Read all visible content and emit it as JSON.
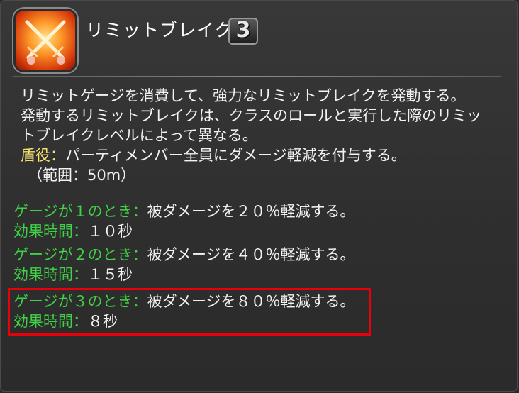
{
  "action": {
    "name": "リミットブレイク",
    "level": "3"
  },
  "description": {
    "line1": "リミットゲージを消費して、強力なリミットブレイクを発動する。",
    "line2": "発動するリミットブレイクは、クラスのロールと実行した際のリミッ",
    "line3": "トブレイクレベルによって異なる。",
    "role_label": "盾役：",
    "role_text": "パーティメンバー全員にダメージ軽減を付与する。",
    "range_text": "（範囲：50m）"
  },
  "gauge_levels": [
    {
      "condition": "ゲージが１のとき：",
      "effect": "被ダメージを２０％軽減する。",
      "duration_label": "効果時間：",
      "duration": "１０秒"
    },
    {
      "condition": "ゲージが２のとき：",
      "effect": "被ダメージを４０％軽減する。",
      "duration_label": "効果時間：",
      "duration": "１５秒"
    },
    {
      "condition": "ゲージが３のとき：",
      "effect": "被ダメージを８０％軽減する。",
      "duration_label": "効果時間：",
      "duration": "８秒"
    }
  ],
  "colors": {
    "background": "#2e2e2e",
    "text": "#f2f2f2",
    "yellow_label": "#f5e26b",
    "green_label": "#3fd146",
    "highlight_border": "#e8000b"
  },
  "icons": {
    "action_icon": "crossed-swords-icon",
    "level_badge": "level-3-badge"
  }
}
